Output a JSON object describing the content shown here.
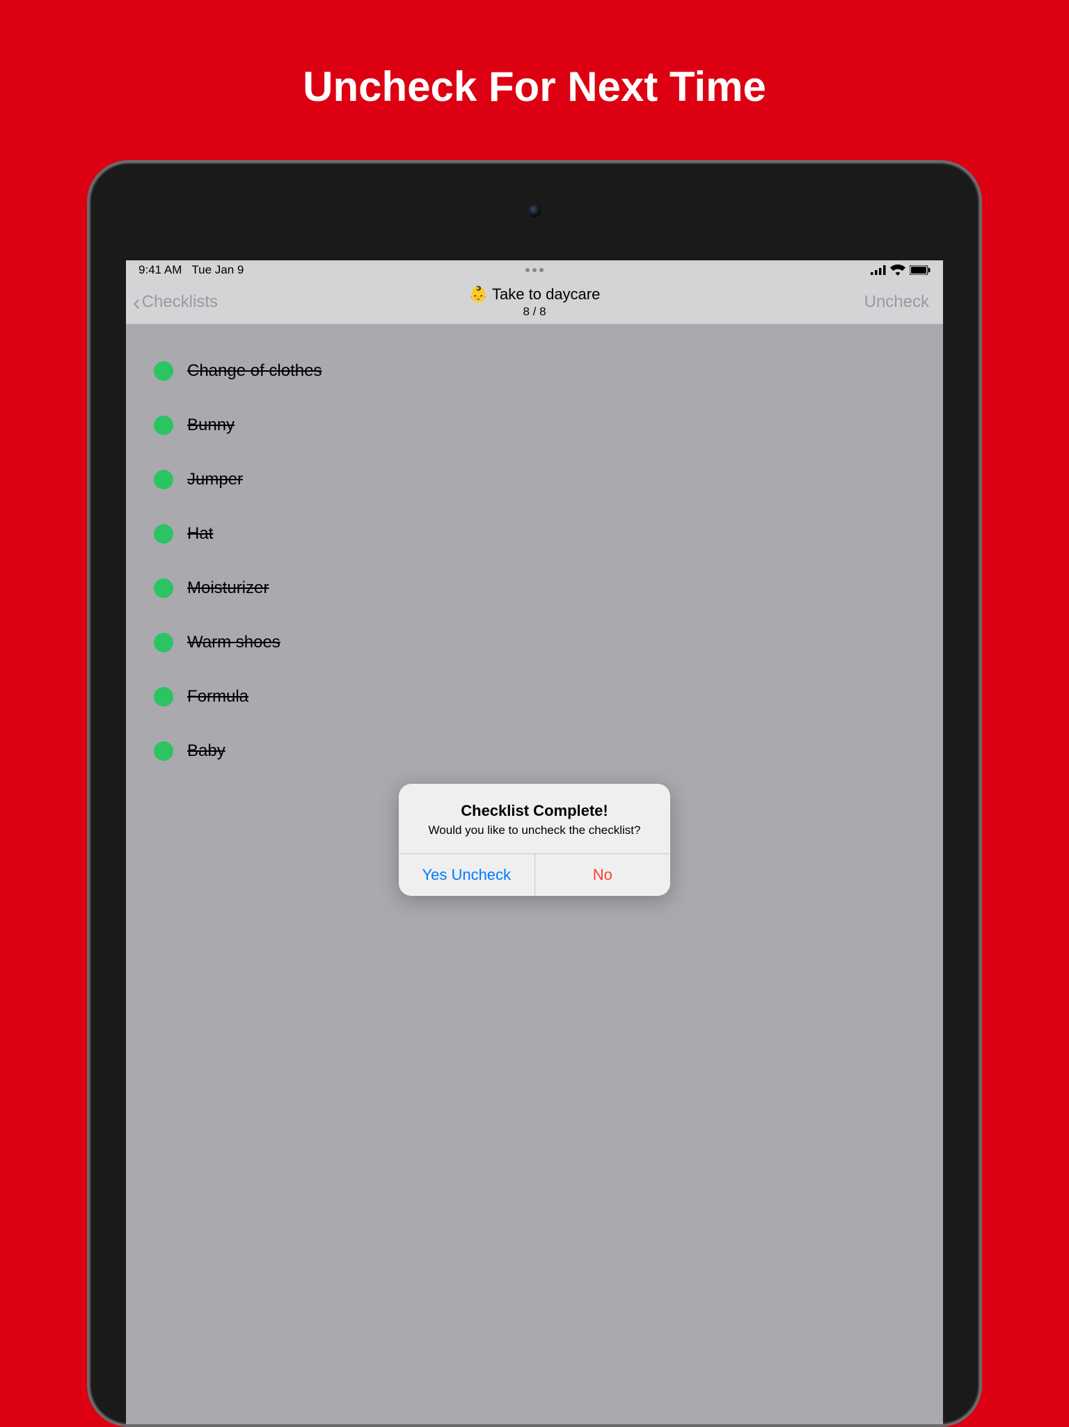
{
  "marketing": {
    "headline": "Uncheck For Next Time"
  },
  "status": {
    "time": "9:41 AM",
    "date": "Tue Jan 9"
  },
  "nav": {
    "back_label": "Checklists",
    "title_emoji": "👶",
    "title": "Take to daycare",
    "subtitle": "8 / 8",
    "right_action": "Uncheck"
  },
  "items": [
    {
      "label": "Change of clothes"
    },
    {
      "label": "Bunny"
    },
    {
      "label": "Jumper"
    },
    {
      "label": "Hat"
    },
    {
      "label": "Moisturizer"
    },
    {
      "label": "Warm shoes"
    },
    {
      "label": "Formula"
    },
    {
      "label": "Baby"
    }
  ],
  "dialog": {
    "title": "Checklist Complete!",
    "message": "Would you like to uncheck the checklist?",
    "yes": "Yes Uncheck",
    "no": "No"
  }
}
